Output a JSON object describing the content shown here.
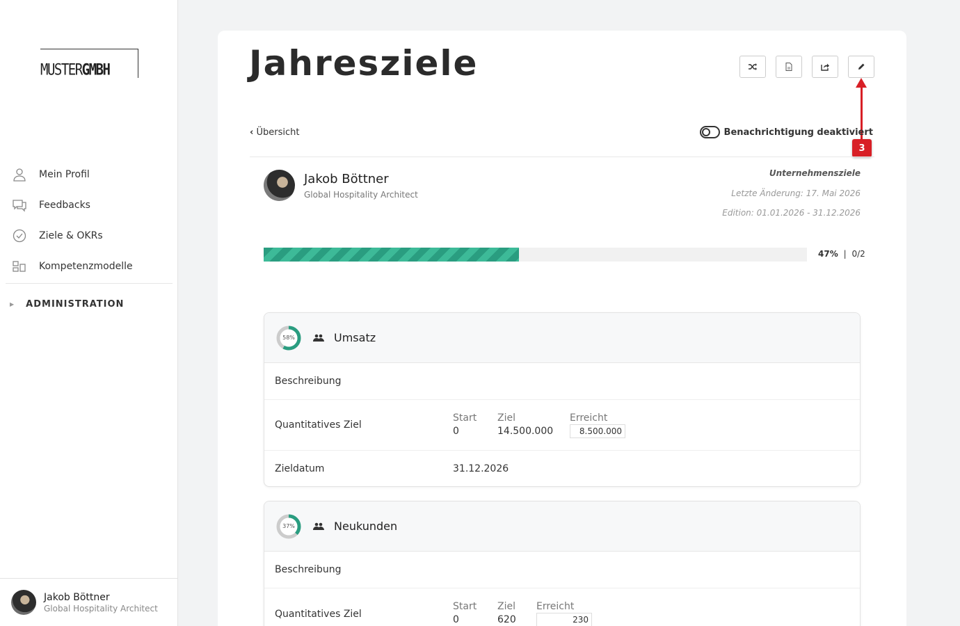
{
  "sidebar": {
    "logo": {
      "part1": "MUSTER",
      "part2": "GMBH"
    },
    "items": [
      {
        "label": "Mein Profil",
        "icon": "user-icon"
      },
      {
        "label": "Feedbacks",
        "icon": "chat-icon"
      },
      {
        "label": "Ziele & OKRs",
        "icon": "check-circle-icon"
      },
      {
        "label": "Kompetenzmodelle",
        "icon": "blocks-icon"
      }
    ],
    "admin": "ADMINISTRATION",
    "user": {
      "name": "Jakob Böttner",
      "role": "Global Hospitality Architect"
    }
  },
  "page": {
    "title": "Jahresziele",
    "back_label": "Übersicht",
    "notification_label": "Benachrichtigung deaktiviert",
    "annotation_badge": "3",
    "toolbar": [
      "shuffle-icon",
      "pdf-icon",
      "share-icon",
      "edit-pencil-icon"
    ]
  },
  "person": {
    "name": "Jakob Böttner",
    "role": "Global Hospitality Architect",
    "category": "Unternehmensziele",
    "last_change": "Letzte Änderung: 17. Mai 2026",
    "edition": "Edition: 01.01.2026 - 31.12.2026"
  },
  "progress": {
    "percent": 47,
    "percent_label": "47%",
    "separator": "|",
    "count": "0/2"
  },
  "goals": [
    {
      "title": "Umsatz",
      "percent": 58,
      "percent_label": "58%",
      "description_label": "Beschreibung",
      "quant_label": "Quantitatives Ziel",
      "start_label": "Start",
      "start": "0",
      "target_label": "Ziel",
      "target": "14.500.000",
      "achieved_label": "Erreicht",
      "achieved": "8.500.000",
      "date_label": "Zieldatum",
      "date": "31.12.2026"
    },
    {
      "title": "Neukunden",
      "percent": 37,
      "percent_label": "37%",
      "description_label": "Beschreibung",
      "quant_label": "Quantitatives Ziel",
      "start_label": "Start",
      "start": "0",
      "target_label": "Ziel",
      "target": "620",
      "achieved_label": "Erreicht",
      "achieved": "230"
    }
  ],
  "colors": {
    "accent": "#2a9d80",
    "annotation": "#d81f26"
  }
}
